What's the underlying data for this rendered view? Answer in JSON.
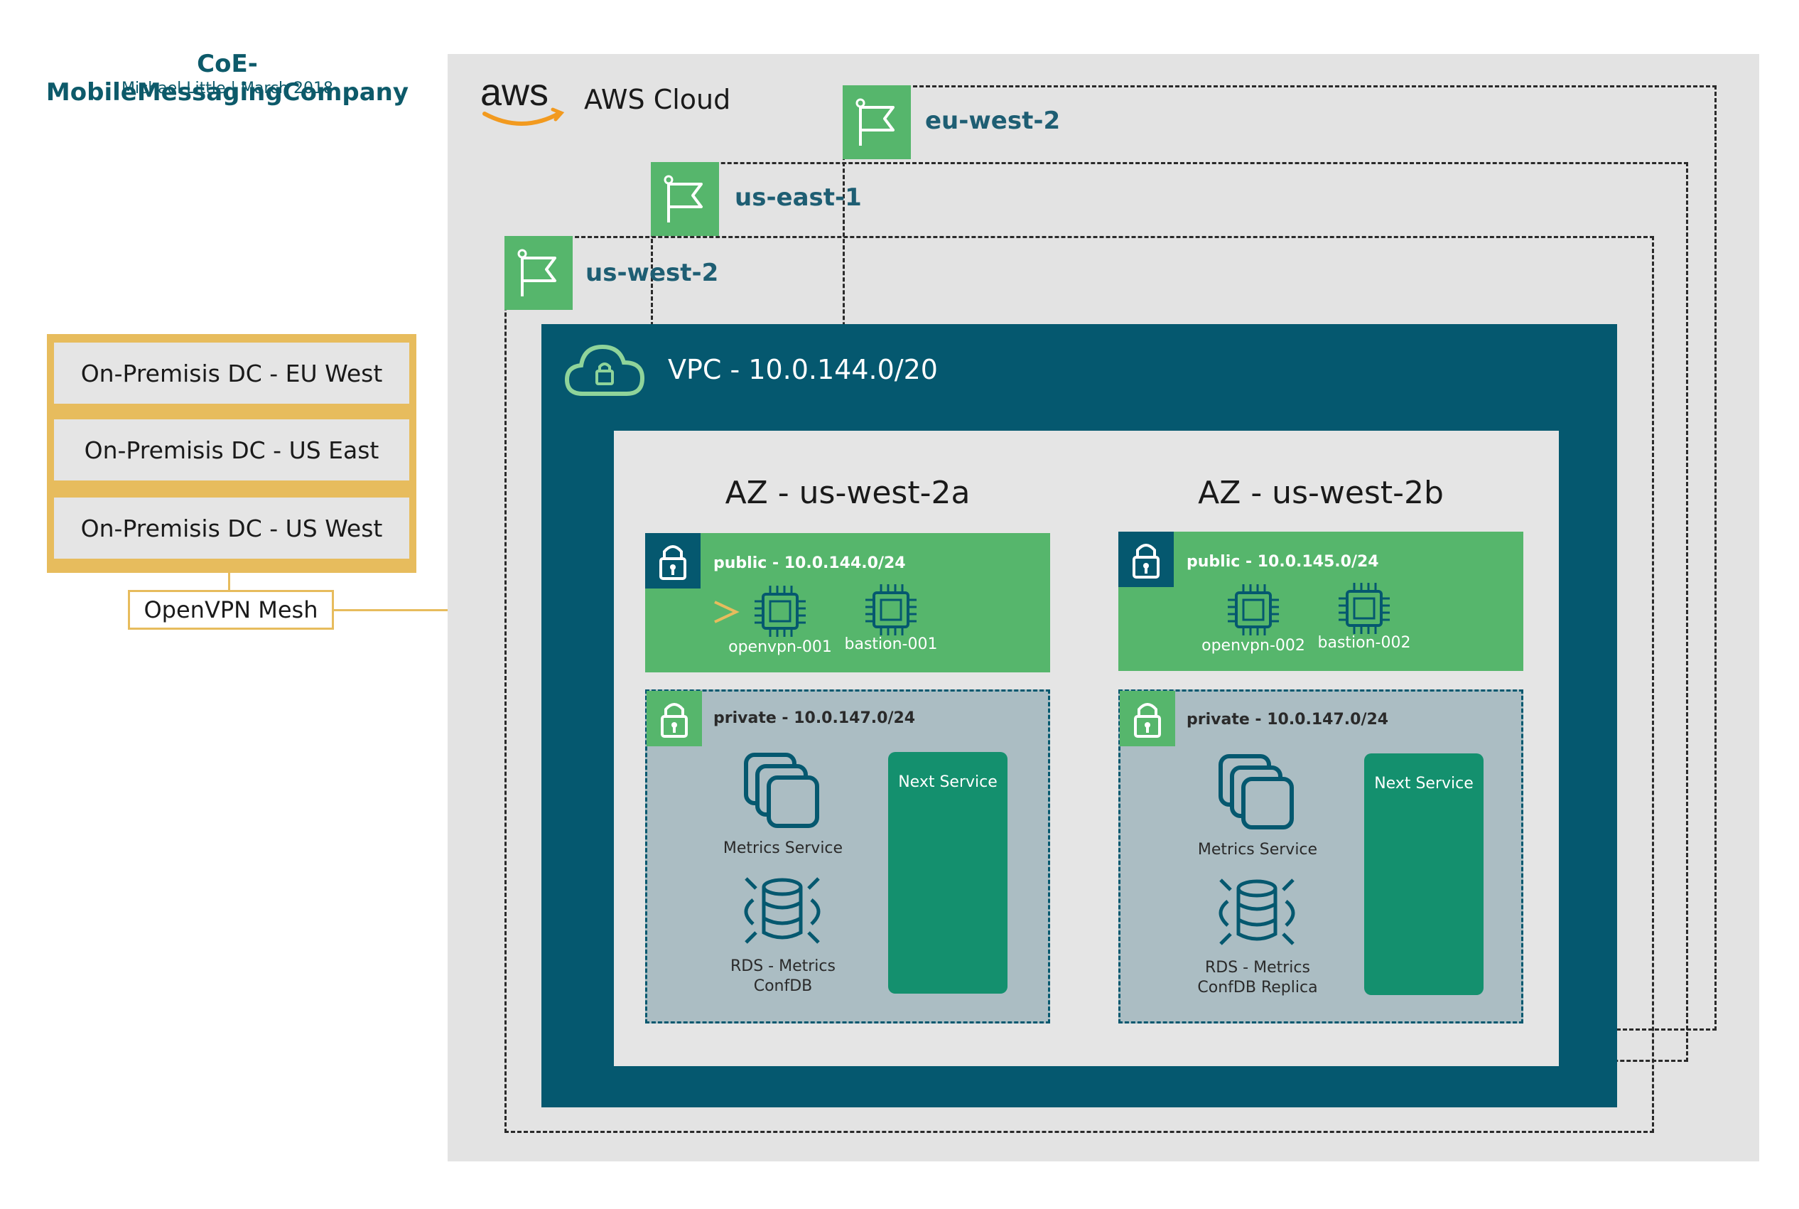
{
  "header": {
    "title": "CoE-MobileMessagingCompany",
    "subtitle": "Michael Little | March 2018"
  },
  "on_premises": {
    "datacenters": [
      "On-Premisis DC - EU West",
      "On-Premisis DC - US East",
      "On-Premisis DC - US West"
    ],
    "vpn_label": "OpenVPN Mesh"
  },
  "aws": {
    "cloud_label": "AWS Cloud",
    "logo_text": "aws",
    "regions": [
      "eu-west-2",
      "us-east-1",
      "us-west-2"
    ],
    "vpc_label": "VPC - 10.0.144.0/20",
    "azs": [
      {
        "title": "AZ - us-west-2a",
        "public_label": "public - 10.0.144.0/24",
        "instances": [
          "openvpn-001",
          "bastion-001"
        ],
        "private_label": "private - 10.0.147.0/24",
        "metrics_label": "Metrics Service",
        "rds_label_line1": "RDS - Metrics",
        "rds_label_line2": "ConfDB",
        "next_service": "Next Service"
      },
      {
        "title": "AZ - us-west-2b",
        "public_label": "public - 10.0.145.0/24",
        "instances": [
          "openvpn-002",
          "bastion-002"
        ],
        "private_label": "private - 10.0.147.0/24",
        "metrics_label": "Metrics Service",
        "rds_label_line1": "RDS - Metrics",
        "rds_label_line2": "ConfDB Replica",
        "next_service": "Next Service"
      }
    ]
  },
  "colors": {
    "teal": "#05586f",
    "green": "#56b66c",
    "gold": "#e7bc5d",
    "gray": "#e3e3e3",
    "private_gray": "#abbdc3",
    "service_green": "#14906e"
  }
}
